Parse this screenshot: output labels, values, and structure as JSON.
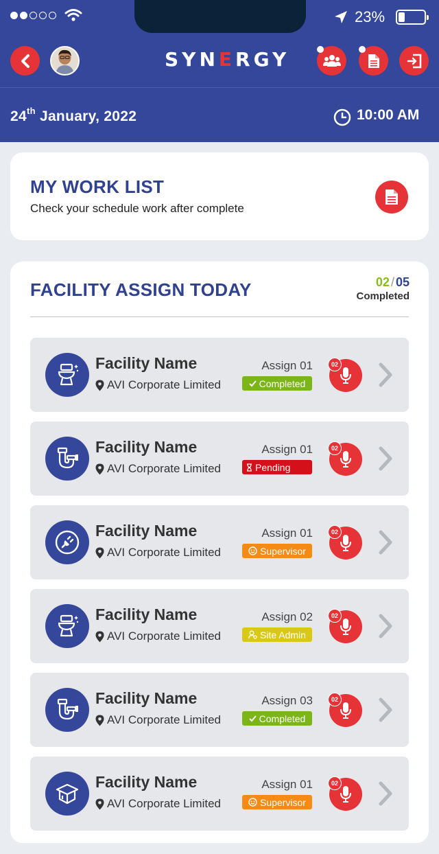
{
  "status": {
    "battery_percent": "23%"
  },
  "header": {
    "logo": {
      "part1": "SYN",
      "part2": "E",
      "part3": "RGY"
    },
    "date": {
      "day": "24",
      "suffix": "th",
      "rest": " January, 2022"
    },
    "time": "10:00 AM",
    "colors": {
      "primary": "#34479a",
      "accent": "#e63338"
    }
  },
  "worklist": {
    "title": "MY WORK LIST",
    "subtitle": "Check your schedule work after complete"
  },
  "facility": {
    "title": "FACILITY ASSIGN TODAY",
    "done": "02",
    "total": "05",
    "status_label": "Completed",
    "items": [
      {
        "name": "Facility Name",
        "location": "AVI Corporate Limited",
        "assign": "Assign 01",
        "status": "Completed",
        "icon": "toilet-icon",
        "audio_count": "02"
      },
      {
        "name": "Facility Name",
        "location": "AVI Corporate Limited",
        "assign": "Assign 01",
        "status": "Pending",
        "icon": "pipe-icon",
        "audio_count": "02"
      },
      {
        "name": "Facility Name",
        "location": "AVI Corporate Limited",
        "assign": "Assign 01",
        "status": "Supervisor",
        "icon": "plug-icon",
        "audio_count": "02"
      },
      {
        "name": "Facility Name",
        "location": "AVI Corporate Limited",
        "assign": "Assign 02",
        "status": "Site Admin",
        "icon": "toilet-icon",
        "audio_count": "02"
      },
      {
        "name": "Facility Name",
        "location": "AVI Corporate Limited",
        "assign": "Assign 03",
        "status": "Completed",
        "icon": "pipe-icon",
        "audio_count": "02"
      },
      {
        "name": "Facility Name",
        "location": "AVI Corporate Limited",
        "assign": "Assign 01",
        "status": "Supervisor",
        "icon": "box-icon",
        "audio_count": "02"
      }
    ]
  }
}
